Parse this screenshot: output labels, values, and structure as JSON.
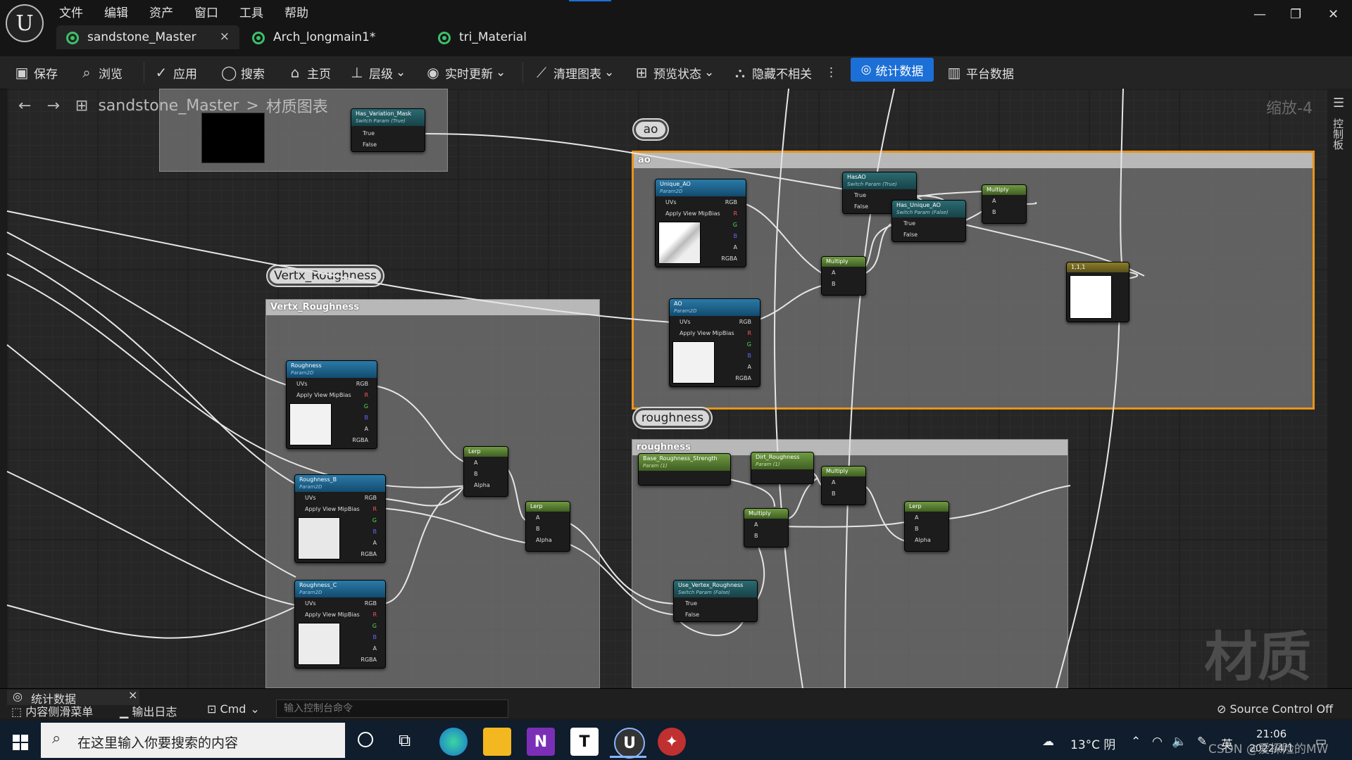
{
  "menu": [
    "文件",
    "编辑",
    "资产",
    "窗口",
    "工具",
    "帮助"
  ],
  "tabs": [
    {
      "label": "sandstone_Master",
      "close": "×"
    },
    {
      "label": "Arch_longmain1*"
    },
    {
      "label": "tri_Material"
    }
  ],
  "window": {
    "minimize": "—",
    "restore": "❐",
    "close": "✕"
  },
  "toolbar": {
    "save": "保存",
    "browse": "浏览",
    "apply": "应用",
    "search": "搜索",
    "home": "主页",
    "hierarchy": "层级",
    "live_update": "实时更新",
    "clean_graph": "清理图表",
    "preview_state": "预览状态",
    "hide_unrelated": "隐藏不相关",
    "more": "⋮",
    "stats": "统计数据",
    "platform_stats": "平台数据"
  },
  "breadcrumb": {
    "asset": "sandstone_Master",
    "sep": ">",
    "graph": "材质图表"
  },
  "zoom": "缩放-4",
  "right_panel": "控制板",
  "watermark": "材质",
  "comments": {
    "ao": {
      "bubble": "ao",
      "header": "ao"
    },
    "vertx": {
      "bubble": "Vertx_Roughness",
      "header": "Vertx_Roughness"
    },
    "roughness": {
      "bubble": "roughness",
      "header": "roughness"
    }
  },
  "nodes": {
    "top_switch": {
      "title": "Has_Variation_Mask",
      "sub": "Switch Param (True)",
      "pins": [
        "True",
        "False"
      ]
    },
    "unique_ao": {
      "title": "Unique_AO",
      "sub": "Param2D",
      "pins": [
        "UVs",
        "Apply View MipBias"
      ],
      "outs": [
        "RGB",
        "R",
        "G",
        "B",
        "A",
        "RGBA"
      ]
    },
    "ao": {
      "title": "AO",
      "sub": "Param2D",
      "pins": [
        "UVs",
        "Apply View MipBias"
      ],
      "outs": [
        "RGB",
        "R",
        "G",
        "B",
        "A",
        "RGBA"
      ]
    },
    "has_ao": {
      "title": "HasAO",
      "sub": "Switch Param (True)",
      "pins": [
        "True",
        "False"
      ]
    },
    "has_unique_ao": {
      "title": "Has_Unique_AO",
      "sub": "Switch Param (False)",
      "pins": [
        "True",
        "False"
      ]
    },
    "multiply_ao1": {
      "title": "Multiply",
      "pins": [
        "A",
        "B"
      ]
    },
    "multiply_ao2": {
      "title": "Multiply",
      "pins": [
        "A",
        "B"
      ]
    },
    "reroute_out": {
      "title": "1,1,1"
    },
    "roughness": {
      "title": "Roughness",
      "sub": "Param2D",
      "pins": [
        "UVs",
        "Apply View MipBias"
      ],
      "outs": [
        "RGB",
        "R",
        "G",
        "B",
        "A",
        "RGBA"
      ]
    },
    "roughness_b": {
      "title": "Roughness_B",
      "sub": "Param2D",
      "pins": [
        "UVs",
        "Apply View MipBias"
      ],
      "outs": [
        "RGB",
        "R",
        "G",
        "B",
        "A",
        "RGBA"
      ]
    },
    "roughness_c": {
      "title": "Roughness_C",
      "sub": "Param2D",
      "pins": [
        "UVs",
        "Apply View MipBias"
      ],
      "outs": [
        "RGB",
        "R",
        "G",
        "B",
        "A",
        "RGBA"
      ]
    },
    "lerp1": {
      "title": "Lerp",
      "pins": [
        "A",
        "B",
        "Alpha"
      ]
    },
    "lerp2": {
      "title": "Lerp",
      "pins": [
        "A",
        "B",
        "Alpha"
      ]
    },
    "base_rough": {
      "title": "Base_Roughness_Strength",
      "sub": "Param (1)"
    },
    "dirt_rough": {
      "title": "Dirt_Roughness",
      "sub": "Param (1)"
    },
    "multiply_r1": {
      "title": "Multiply",
      "pins": [
        "A",
        "B"
      ]
    },
    "multiply_r2": {
      "title": "Multiply",
      "pins": [
        "A",
        "B"
      ]
    },
    "lerp3": {
      "title": "Lerp",
      "pins": [
        "A",
        "B",
        "Alpha"
      ]
    },
    "use_vertex": {
      "title": "Use_Vertex_Roughness",
      "sub": "Switch Param (False)",
      "pins": [
        "True",
        "False"
      ]
    }
  },
  "bottom": {
    "stats_tab": "统计数据",
    "stats_close": "×",
    "content_drawer": "内容侧滑菜单",
    "output_log": "输出日志",
    "cmd": "Cmd",
    "console_placeholder": "输入控制台命令",
    "source_control": "Source Control Off"
  },
  "taskbar": {
    "search_placeholder": "在这里输入你要搜索的内容",
    "weather": "13°C 阴",
    "time": "21:06",
    "date": "2022/4/1",
    "ime": "英",
    "csdn": "CSDN @爱探险的MW",
    "apps": [
      "edge-icon",
      "explorer-icon",
      "onenote-icon",
      "typora-icon",
      "unreal-icon",
      "tool-icon"
    ]
  }
}
